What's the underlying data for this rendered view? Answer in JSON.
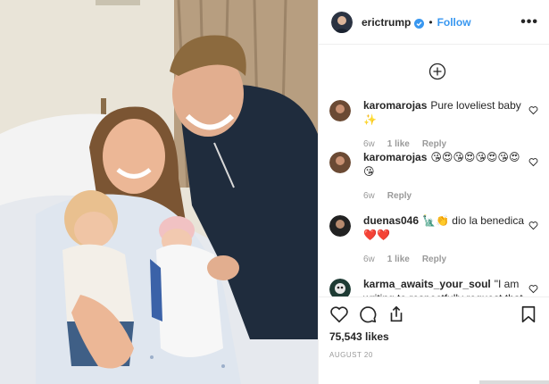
{
  "header": {
    "username": "erictrump",
    "separator": "•",
    "follow_label": "Follow",
    "more_label": "•••"
  },
  "comments": [
    {
      "user": "karomarojas",
      "text": "Pure loveliest baby ✨",
      "age": "6w",
      "likes": "1 like",
      "reply": "Reply"
    },
    {
      "user": "karomarojas",
      "text": "😘😍😘😍😘😍😘😍😘",
      "age": "6w",
      "likes": "",
      "reply": "Reply"
    },
    {
      "user": "duenas046",
      "text": "🗽👏 dio la benedica ❤️❤️",
      "age": "6w",
      "likes": "1 like",
      "reply": "Reply"
    },
    {
      "user": "karma_awaits_your_soul",
      "text": "\"I am writing to respectfully request that",
      "age": "",
      "likes": "",
      "reply": ""
    }
  ],
  "footer": {
    "likes": "75,543 likes",
    "date": "AUGUST 20"
  },
  "colors": {
    "accent": "#3897f0",
    "verified": "#3897f0",
    "heart_red": "#ed4956",
    "muted": "#999999"
  },
  "icons": {
    "like": "heart-outline",
    "comment": "speech-bubble",
    "share": "share-arrow",
    "save": "bookmark",
    "load_more": "plus-circle"
  }
}
